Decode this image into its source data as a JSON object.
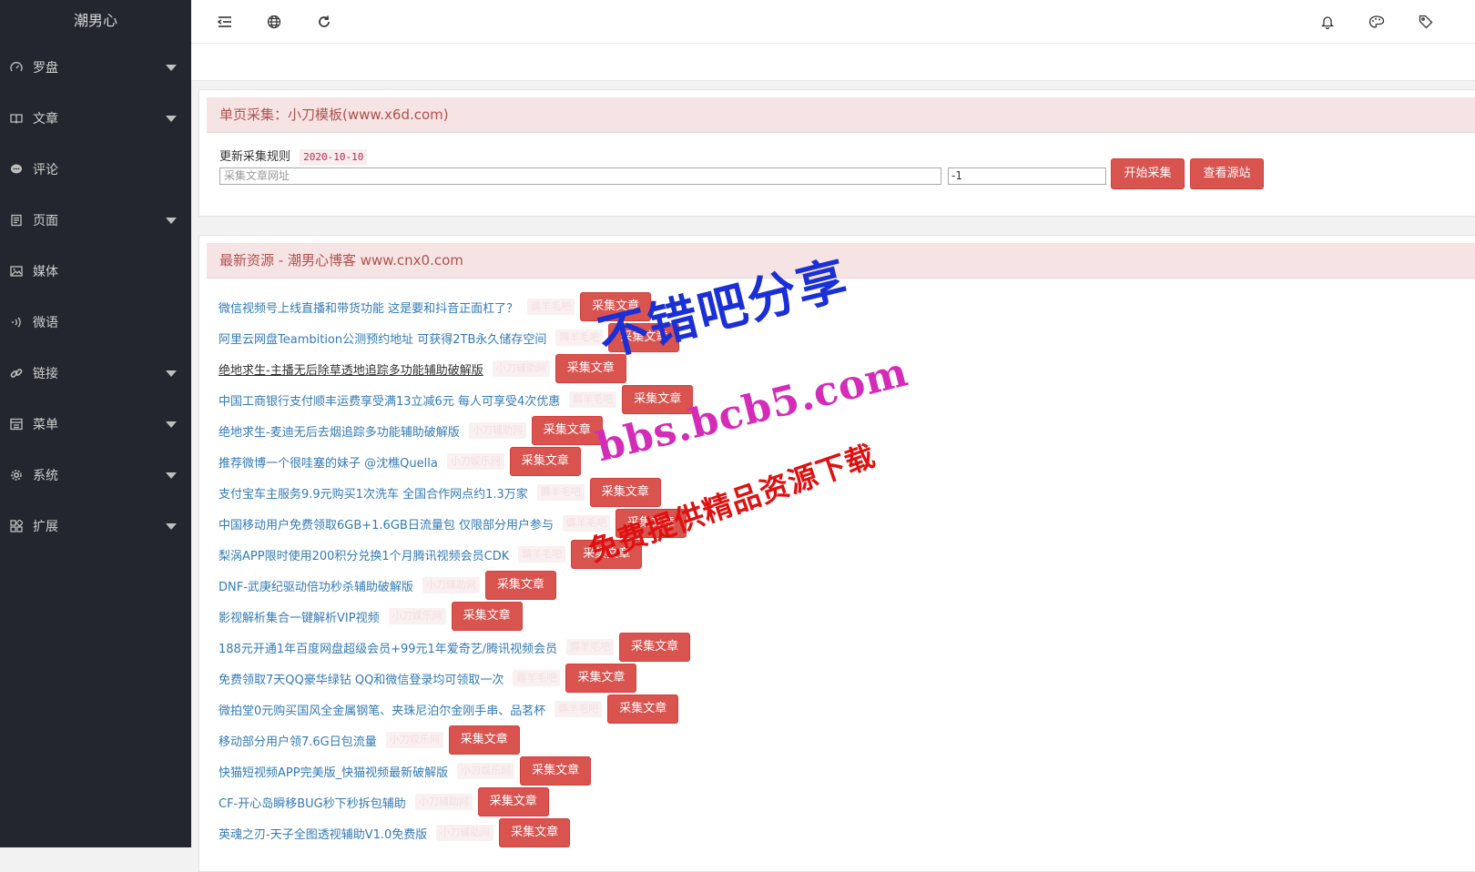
{
  "sidebar": {
    "brand": "潮男心",
    "items": [
      {
        "label": "罗盘",
        "icon": "dashboard-icon",
        "has_caret": true
      },
      {
        "label": "文章",
        "icon": "book-icon",
        "has_caret": true
      },
      {
        "label": "评论",
        "icon": "comment-icon",
        "has_caret": false
      },
      {
        "label": "页面",
        "icon": "page-icon",
        "has_caret": true
      },
      {
        "label": "媒体",
        "icon": "image-icon",
        "has_caret": false
      },
      {
        "label": "微语",
        "icon": "sound-icon",
        "has_caret": false
      },
      {
        "label": "链接",
        "icon": "link-icon",
        "has_caret": true
      },
      {
        "label": "菜单",
        "icon": "menu-icon",
        "has_caret": true
      },
      {
        "label": "系统",
        "icon": "gear-icon",
        "has_caret": true
      },
      {
        "label": "扩展",
        "icon": "apps-icon",
        "has_caret": true
      }
    ]
  },
  "header": {
    "left_icons": [
      "collapse-menu-icon",
      "globe-icon",
      "refresh-icon"
    ],
    "right_icons": [
      "bell-icon",
      "palette-icon",
      "tag-icon"
    ]
  },
  "collect_panel": {
    "title": "单页采集：小刀模板(www.x6d.com)",
    "rule_label": "更新采集规则",
    "rule_date": "2020-10-10",
    "url_placeholder": "采集文章网址",
    "num_value": "-1",
    "start_button": "开始采集",
    "view_source_button": "查看源站"
  },
  "resource_panel": {
    "title": "最新资源 - 潮男心博客 www.cnx0.com",
    "button_label": "采集文章",
    "items": [
      {
        "title": "微信视频号上线直播和带货功能 这是要和抖音正面杠了？",
        "tag": "薅羊毛吧"
      },
      {
        "title": "阿里云网盘Teambition公测预约地址 可获得2TB永久储存空间",
        "tag": "薅羊毛吧"
      },
      {
        "title": "绝地求生-主播无后除草透地追踪多功能辅助破解版",
        "tag": "小刀辅助网"
      },
      {
        "title": "中国工商银行支付顺丰运费享受满13立减6元 每人可享受4次优惠",
        "tag": "薅羊毛吧"
      },
      {
        "title": "绝地求生-麦迪无后去烟追踪多功能辅助破解版",
        "tag": "小刀辅助网"
      },
      {
        "title": "推荐微博一个很哇塞的妹子 @沈樵Quella",
        "tag": "小刀娱乐网"
      },
      {
        "title": "支付宝车主服务9.9元购买1次洗车 全国合作网点约1.3万家",
        "tag": "薅羊毛吧"
      },
      {
        "title": "中国移动用户免费领取6GB+1.6GB日流量包 仅限部分用户参与",
        "tag": "薅羊毛吧"
      },
      {
        "title": "梨涡APP限时使用200积分兑换1个月腾讯视频会员CDK",
        "tag": "薅羊毛吧"
      },
      {
        "title": "DNF-武庚纪驱动倍功秒杀辅助破解版",
        "tag": "小刀辅助网"
      },
      {
        "title": "影视解析集合一键解析VIP视频",
        "tag": "小刀娱乐网"
      },
      {
        "title": "188元开通1年百度网盘超级会员+99元1年爱奇艺/腾讯视频会员",
        "tag": "薅羊毛吧"
      },
      {
        "title": "免费领取7天QQ豪华绿钻 QQ和微信登录均可领取一次",
        "tag": "薅羊毛吧"
      },
      {
        "title": "微拍堂0元购买国风全金属钢笔、夹珠尼泊尔金刚手串、品茗杯",
        "tag": "薅羊毛吧"
      },
      {
        "title": "移动部分用户领7.6G日包流量",
        "tag": "小刀娱乐网"
      },
      {
        "title": "快猫短视频APP完美版_快猫视频最新破解版",
        "tag": "小刀娱乐网"
      },
      {
        "title": "CF-开心岛瞬移BUG秒下秒拆包辅助",
        "tag": "小刀辅助网"
      },
      {
        "title": "英魂之刃-天子全图透视辅助V1.0免费版",
        "tag": "小刀辅助网"
      }
    ]
  },
  "watermark": {
    "line1": "不错吧分享",
    "line2": "bbs.bcb5.com",
    "line3": "免费提供精品资源下载",
    "color_blue": "#1a2fd6",
    "color_red": "#e01010",
    "color_magenta": "#d42bb8"
  },
  "colors": {
    "accent": "#d9534f",
    "sidebar_bg": "#23262e",
    "panel_head_bg": "#f6e4e4",
    "link": "#337ab7"
  }
}
